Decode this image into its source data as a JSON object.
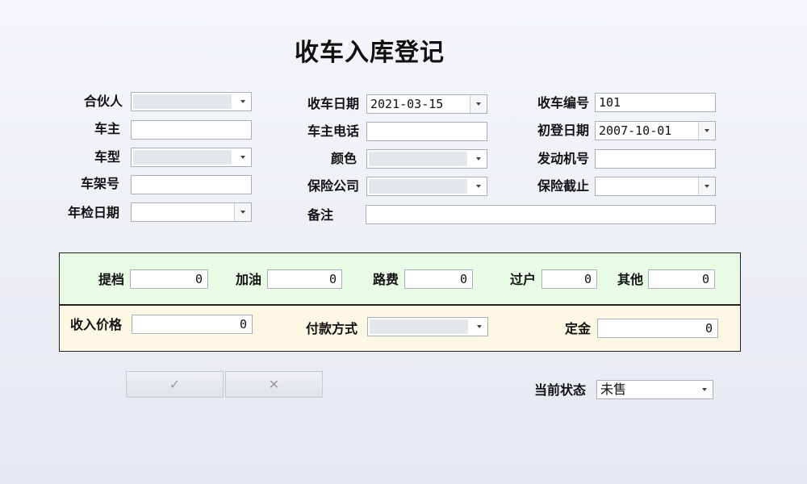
{
  "title": "收车入库登记",
  "form": {
    "partner_label": "合伙人",
    "owner_label": "车主",
    "model_label": "车型",
    "vin_label": "车架号",
    "inspection_label": "年检日期",
    "date_label": "收车日期",
    "date_value": "2021-03-15",
    "phone_label": "车主电话",
    "color_label": "颜色",
    "insurer_label": "保险公司",
    "remark_label": "备注",
    "number_label": "收车编号",
    "number_value": "101",
    "firstreg_label": "初登日期",
    "firstreg_value": "2007-10-01",
    "engine_label": "发动机号",
    "insure_end_label": "保险截止"
  },
  "costs": {
    "tidang_label": "提档",
    "tidang_value": "0",
    "fuel_label": "加油",
    "fuel_value": "0",
    "toll_label": "路费",
    "toll_value": "0",
    "transfer_label": "过户",
    "transfer_value": "0",
    "other_label": "其他",
    "other_value": "0"
  },
  "price": {
    "income_label": "收入价格",
    "income_value": "0",
    "payment_label": "付款方式",
    "deposit_label": "定金",
    "deposit_value": "0"
  },
  "buttons": {
    "ok_icon": "✓",
    "cancel_icon": "✕"
  },
  "status": {
    "label": "当前状态",
    "value": "未售"
  }
}
